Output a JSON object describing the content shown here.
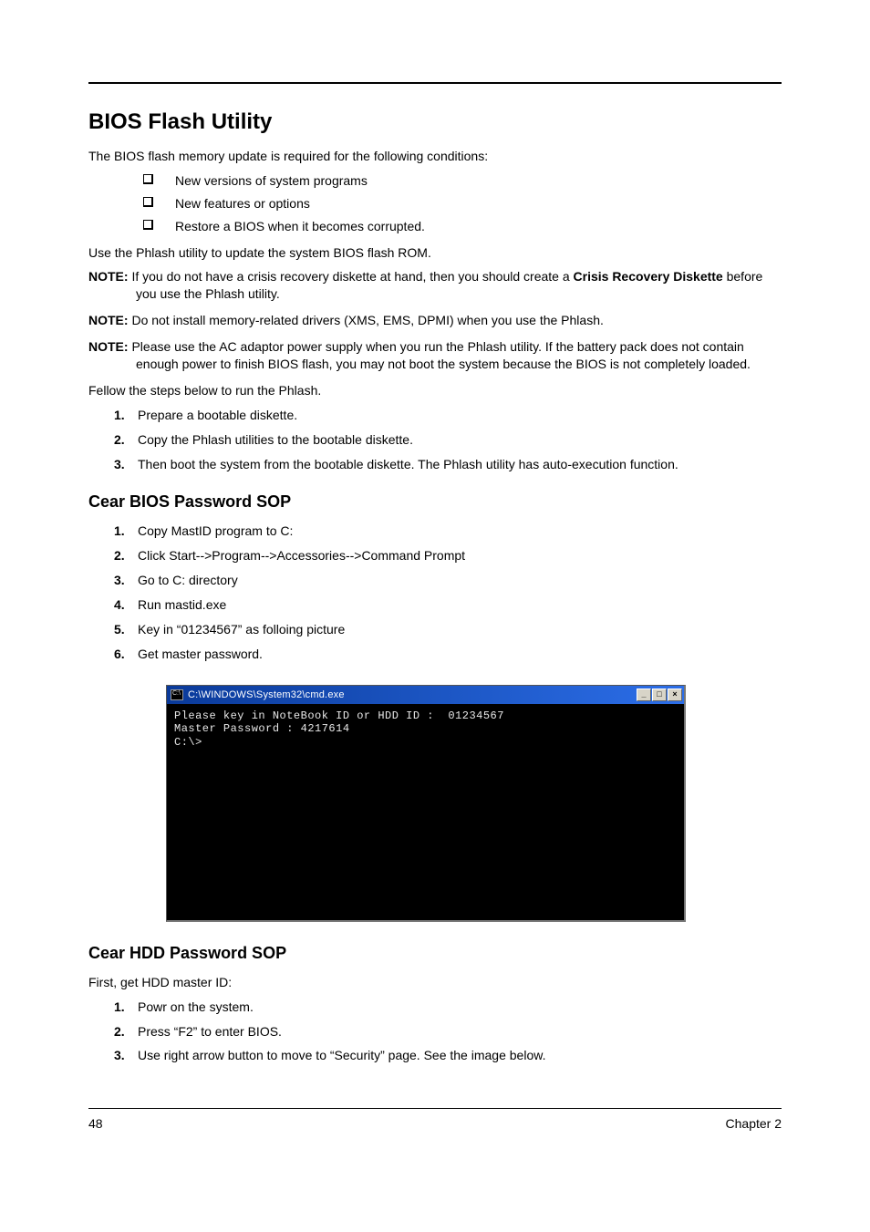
{
  "h1": "BIOS Flash Utility",
  "intro": "The BIOS flash memory update is required for the following conditions:",
  "bullets": [
    "New versions of system programs",
    "New features or options",
    "Restore a BIOS when it becomes corrupted."
  ],
  "after_bullets": "Use the Phlash utility to update the system BIOS flash ROM.",
  "notes": [
    {
      "label": "NOTE: ",
      "pre": "If you do not have a crisis recovery diskette at hand, then you should create a ",
      "bold": "Crisis Recovery Diskette",
      "post": " before you use the Phlash utility."
    },
    {
      "label": "NOTE: ",
      "pre": "Do not install memory-related drivers (XMS, EMS, DPMI) when you use the Phlash.",
      "bold": "",
      "post": ""
    },
    {
      "label": "NOTE: ",
      "pre": "Please use the AC adaptor power supply when you run the Phlash utility. If the battery pack does not contain enough power to finish BIOS flash, you may not boot the system because the BIOS is not completely loaded.",
      "bold": "",
      "post": ""
    }
  ],
  "fellow": "Fellow the steps below to run the Phlash.",
  "phlash_steps": [
    "Prepare a bootable diskette.",
    "Copy the Phlash utilities to the bootable diskette.",
    "Then boot the system from the bootable diskette. The Phlash utility has auto-execution function."
  ],
  "h2_bios": "Cear BIOS Password SOP",
  "bios_steps": [
    "Copy MastID program to C:",
    "Click Start-->Program-->Accessories-->Command Prompt",
    "Go to C: directory",
    "Run mastid.exe",
    "Key in “01234567” as folloing picture",
    "Get master password."
  ],
  "cmd": {
    "title": "C:\\WINDOWS\\System32\\cmd.exe",
    "icon_text": "C:\\",
    "body": "Please key in NoteBook ID or HDD ID :  01234567\nMaster Password : 4217614\nC:\\>"
  },
  "h2_hdd": "Cear HDD Password SOP",
  "hdd_intro": "First, get HDD master ID:",
  "hdd_steps": [
    "Powr on the system.",
    "Press “F2” to enter BIOS.",
    "Use right arrow button to move to “Security” page. See the image below."
  ],
  "footer": {
    "left": "48",
    "right": "Chapter 2"
  }
}
